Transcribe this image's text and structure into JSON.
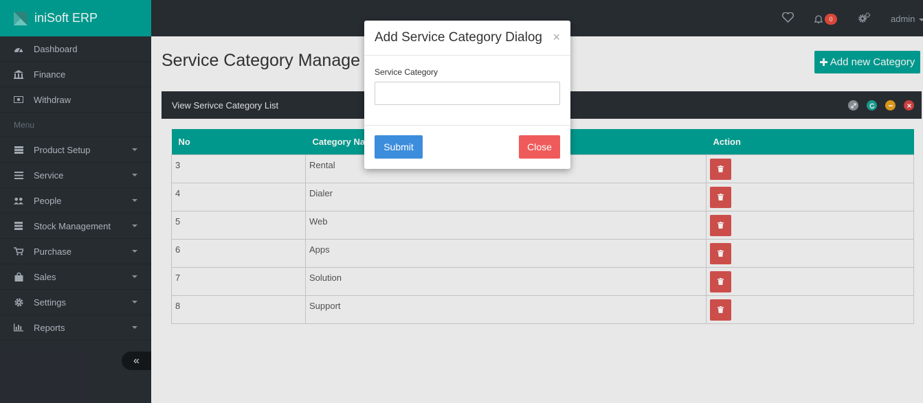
{
  "brand": {
    "name": "iniSoft ERP",
    "logo_icon": "app-logo-icon"
  },
  "sidebar": {
    "top_items": [
      {
        "label": "Dashboard",
        "icon": "dashboard-icon"
      },
      {
        "label": "Finance",
        "icon": "bank-icon"
      },
      {
        "label": "Withdraw",
        "icon": "money-icon"
      }
    ],
    "menu_header": "Menu",
    "menu_items": [
      {
        "label": "Product Setup",
        "icon": "list-icon"
      },
      {
        "label": "Service",
        "icon": "bars-icon"
      },
      {
        "label": "People",
        "icon": "users-icon"
      },
      {
        "label": "Stock Management",
        "icon": "stock-icon"
      },
      {
        "label": "Purchase",
        "icon": "cart-icon"
      },
      {
        "label": "Sales",
        "icon": "shopping-bag-icon"
      },
      {
        "label": "Settings",
        "icon": "gear-icon"
      },
      {
        "label": "Reports",
        "icon": "bar-chart-icon"
      }
    ],
    "collapse_symbol": "«"
  },
  "topbar": {
    "notification_count": "0",
    "user_label": "admin"
  },
  "page": {
    "title": "Service Category Manage",
    "add_button": "Add new Category"
  },
  "panel": {
    "title": "View Serivce Category List"
  },
  "table": {
    "headers": [
      "No",
      "Category Name",
      "Action"
    ],
    "rows": [
      {
        "no": "3",
        "name": "Rental"
      },
      {
        "no": "4",
        "name": "Dialer"
      },
      {
        "no": "5",
        "name": "Web"
      },
      {
        "no": "6",
        "name": "Apps"
      },
      {
        "no": "7",
        "name": "Solution"
      },
      {
        "no": "8",
        "name": "Support"
      }
    ]
  },
  "modal": {
    "title": "Add Service Category Dialog",
    "close_symbol": "×",
    "field_label": "Service Category",
    "field_value": "",
    "submit_label": "Submit",
    "close_label": "Close"
  },
  "colors": {
    "brand": "#00a295",
    "dark": "#2a2f35",
    "danger": "#d9534f",
    "primary": "#3c8ddc"
  }
}
